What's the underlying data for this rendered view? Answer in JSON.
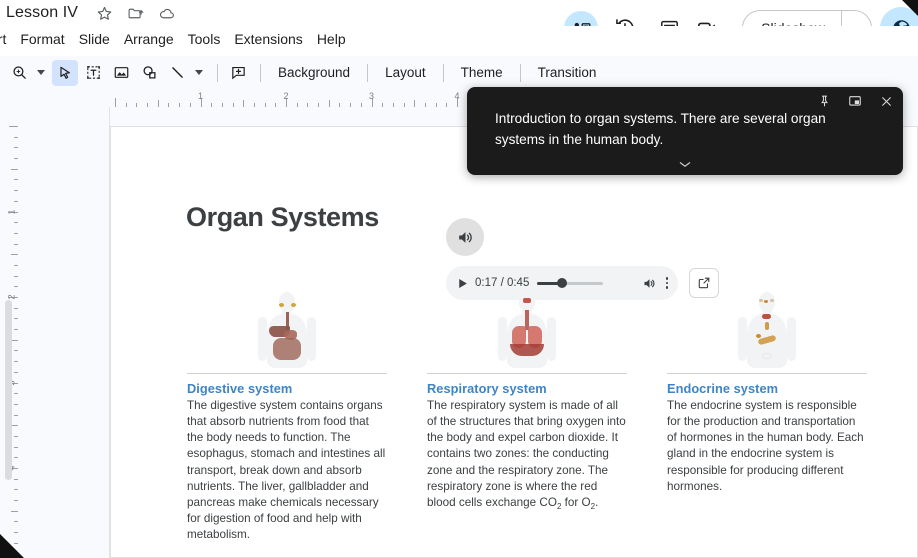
{
  "window": {
    "doc_title": "Lesson IV",
    "title_icons": [
      "star-icon",
      "move-to-folder-icon",
      "cloud-saved-icon"
    ]
  },
  "menubar": {
    "items": [
      {
        "label": "sert",
        "name": "menu-insert"
      },
      {
        "label": "Format",
        "name": "menu-format"
      },
      {
        "label": "Slide",
        "name": "menu-slide"
      },
      {
        "label": "Arrange",
        "name": "menu-arrange"
      },
      {
        "label": "Tools",
        "name": "menu-tools"
      },
      {
        "label": "Extensions",
        "name": "menu-extensions"
      },
      {
        "label": "Help",
        "name": "menu-help"
      }
    ]
  },
  "header_actions": {
    "present_icon": "present-to-meeting-icon",
    "history_icon": "version-history-icon",
    "comments_icon": "comments-icon",
    "meet_icon": "video-camera-icon",
    "slideshow_label": "Slideshow",
    "share_icon": "globe-share-icon"
  },
  "toolbar": {
    "icons": [
      {
        "name": "zoom-icon",
        "label": "Zoom"
      },
      {
        "name": "select-cursor-icon",
        "label": "Select"
      },
      {
        "name": "text-box-icon",
        "label": "Text box"
      },
      {
        "name": "insert-image-icon",
        "label": "Image"
      },
      {
        "name": "shape-icon",
        "label": "Shape"
      },
      {
        "name": "line-icon",
        "label": "Line"
      },
      {
        "name": "add-comment-icon",
        "label": "Comment"
      }
    ],
    "buttons": [
      {
        "label": "Background",
        "name": "background-button"
      },
      {
        "label": "Layout",
        "name": "layout-button"
      },
      {
        "label": "Theme",
        "name": "theme-button"
      },
      {
        "label": "Transition",
        "name": "transition-button"
      }
    ]
  },
  "rulers": {
    "horizontal_numbers": [
      "1",
      "2",
      "3",
      "4"
    ],
    "vertical_numbers": [
      "1",
      "2",
      "3",
      "4",
      "5"
    ]
  },
  "slide": {
    "title": "Organ Systems",
    "columns": [
      {
        "art": "digestive-system-figure",
        "heading": "Digestive system",
        "body": "The digestive system contains organs that absorb nutrients from food that the body needs to function. The esophagus, stomach and intestines all transport, break down and absorb nutrients. The liver, gallbladder and pancreas make chemicals necessary for digestion of food and help with metabolism."
      },
      {
        "art": "respiratory-system-figure",
        "heading": "Respiratory system",
        "body_part1": "The respiratory system is made of all of the structures that bring oxygen into the body and expel carbon dioxide. It contains two zones: the conducting zone and the respiratory zone. The respiratory zone is where the red blood cells exchange CO",
        "sub1": "2",
        "body_part2": " for O",
        "sub2": "2",
        "body_part3": "."
      },
      {
        "art": "endocrine-system-figure",
        "heading": "Endocrine system",
        "body": "The endocrine system is responsible for the production and transportation of hormones in the human body. Each gland in the endocrine system is responsible for producing different hormones."
      }
    ]
  },
  "audio": {
    "speaker_badge_icon": "speaker-icon",
    "play_icon": "play-icon",
    "time": "0:17 / 0:45",
    "volume_icon": "volume-icon",
    "more_icon": "more-options-icon",
    "open_icon": "open-in-new-icon",
    "progress_percent": 38
  },
  "captions": {
    "text": "Introduction to organ systems. There are several organ systems in the human body.",
    "pin_icon": "pin-icon",
    "pip_icon": "picture-in-picture-icon",
    "close_icon": "close-icon",
    "expand_icon": "chevron-down-icon"
  },
  "colors": {
    "heading_blue": "#3d85c8",
    "accent_blue": "#c2e7ff",
    "toolbar_bg": "#f8fafd",
    "caption_bg": "#1b1b1b"
  }
}
